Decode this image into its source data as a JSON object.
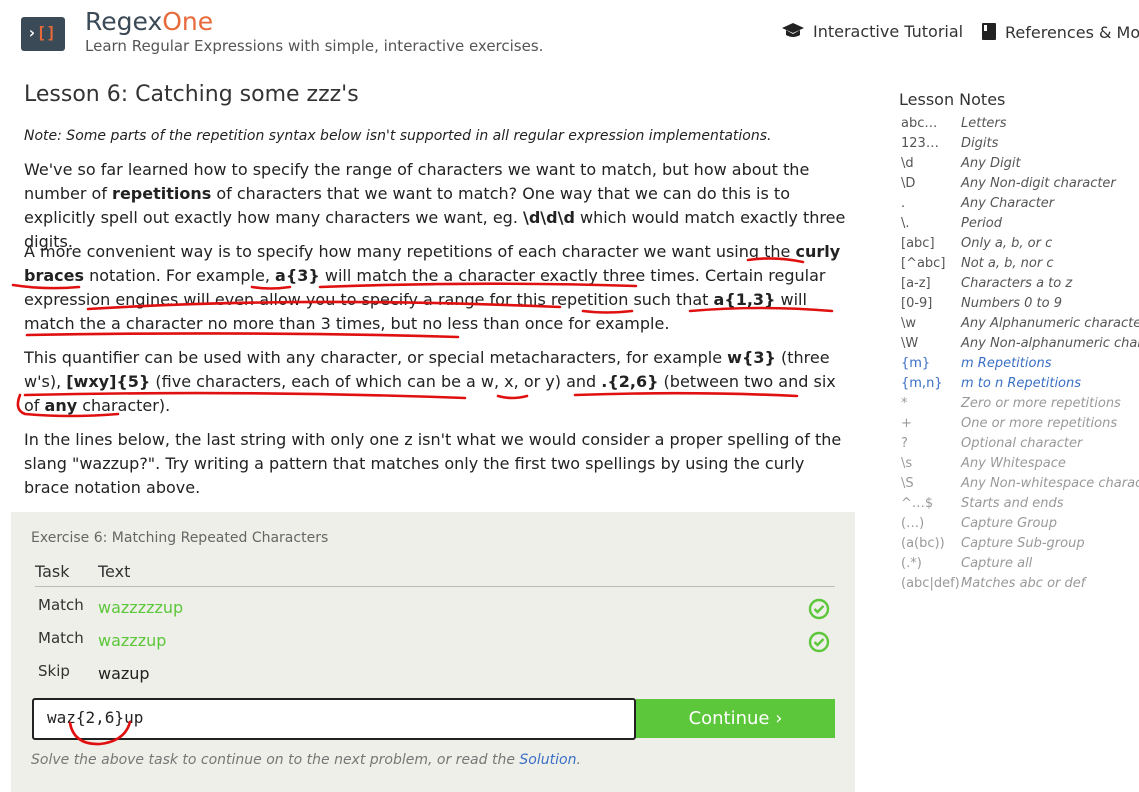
{
  "header": {
    "brand_prefix": "Regex",
    "brand_suffix": "One",
    "tagline": "Learn Regular Expressions with simple, interactive exercises.",
    "nav_tutorial": "Interactive Tutorial",
    "nav_references": "References & Mor"
  },
  "lesson": {
    "title": "Lesson 6: Catching some zzz's",
    "note": "Note: Some parts of the repetition syntax below isn't supported in all regular expression implementations.",
    "p1": [
      {
        "t": "We've so far learned how to specify the range of characters we want to match, but how about the number of "
      },
      {
        "t": "repetitions",
        "b": true
      },
      {
        "t": " of characters that we want to match? One way that we can do this is to explicitly spell out exactly how many characters we want, eg. "
      },
      {
        "t": "\\d\\d\\d",
        "b": true
      },
      {
        "t": " which would match exactly three digits."
      }
    ],
    "p2": [
      {
        "t": "A more convenient way is to specify how many repetitions of each character we want using the "
      },
      {
        "t": "curly braces",
        "b": true
      },
      {
        "t": " notation. For example, "
      },
      {
        "t": "a{3}",
        "b": true
      },
      {
        "t": " will match the a character exactly three times. Certain regular expression engines will even allow you to specify a range for this repetition such that "
      },
      {
        "t": "a{1,3}",
        "b": true
      },
      {
        "t": " will match the a character no more than 3 times, but no less than once for example."
      }
    ],
    "p3": [
      {
        "t": "This quantifier can be used with any character, or special metacharacters, for example "
      },
      {
        "t": "w{3}",
        "b": true
      },
      {
        "t": " (three w's), "
      },
      {
        "t": "[wxy]{5}",
        "b": true
      },
      {
        "t": " (five characters, each of which can be a w, x, or y) and "
      },
      {
        "t": ".{2,6}",
        "b": true
      },
      {
        "t": " (between two and six of "
      },
      {
        "t": "any",
        "b": true
      },
      {
        "t": " character)."
      }
    ],
    "p4": "In the lines below, the last string with only one z isn't what we would consider a proper spelling of the slang \"wazzup?\". Try writing a pattern that matches only the first two spellings by using the curly brace notation above."
  },
  "exercise": {
    "title": "Exercise 6: Matching Repeated Characters",
    "col_task": "Task",
    "col_text": "Text",
    "rows": [
      {
        "task": "Match",
        "text": "wazzzzzup"
      },
      {
        "task": "Match",
        "text": "wazzzup"
      },
      {
        "task": "Skip",
        "text": "wazup"
      }
    ],
    "input_value": "waz{2,6}up",
    "continue_label": "Continue ›",
    "hint_prefix": "Solve the above task to continue on to the next problem, or read the ",
    "hint_link": "Solution",
    "hint_suffix": "."
  },
  "notes": {
    "title": "Lesson Notes",
    "items": [
      {
        "k": "abc…",
        "v": "Letters",
        "s": "n"
      },
      {
        "k": "123…",
        "v": "Digits",
        "s": "n"
      },
      {
        "k": "\\d",
        "v": "Any Digit",
        "s": "n"
      },
      {
        "k": "\\D",
        "v": "Any Non-digit character",
        "s": "n"
      },
      {
        "k": ".",
        "v": "Any Character",
        "s": "n"
      },
      {
        "k": "\\.",
        "v": "Period",
        "s": "n"
      },
      {
        "k": "[abc]",
        "v": "Only a, b, or c",
        "s": "n"
      },
      {
        "k": "[^abc]",
        "v": "Not a, b, nor c",
        "s": "n"
      },
      {
        "k": "[a-z]",
        "v": "Characters a to z",
        "s": "n"
      },
      {
        "k": "[0-9]",
        "v": "Numbers 0 to 9",
        "s": "n"
      },
      {
        "k": "\\w",
        "v": "Any Alphanumeric character",
        "s": "n"
      },
      {
        "k": "\\W",
        "v": "Any Non-alphanumeric charac",
        "s": "n"
      },
      {
        "k": "{m}",
        "v": "m Repetitions",
        "s": "hl"
      },
      {
        "k": "{m,n}",
        "v": "m to n Repetitions",
        "s": "hl"
      },
      {
        "k": "*",
        "v": "Zero or more repetitions",
        "s": "dim"
      },
      {
        "k": "+",
        "v": "One or more repetitions",
        "s": "dim"
      },
      {
        "k": "?",
        "v": "Optional character",
        "s": "dim"
      },
      {
        "k": "\\s",
        "v": "Any Whitespace",
        "s": "dim"
      },
      {
        "k": "\\S",
        "v": "Any Non-whitespace characte",
        "s": "dim"
      },
      {
        "k": "^…$",
        "v": "Starts and ends",
        "s": "dim"
      },
      {
        "k": "(…)",
        "v": "Capture Group",
        "s": "dim"
      },
      {
        "k": "(a(bc))",
        "v": "Capture Sub-group",
        "s": "dim"
      },
      {
        "k": "(.*)",
        "v": "Capture all",
        "s": "dim"
      },
      {
        "k": "(abc|def)",
        "v": "Matches abc or def",
        "s": "dim"
      }
    ]
  },
  "colors": {
    "accent": "#e86a3a",
    "success": "#5cc73a",
    "link": "#3a6fc4",
    "annotation": "#e01010"
  },
  "icons": [
    "logo-icon",
    "graduation-cap-icon",
    "book-icon",
    "check-circle-icon"
  ]
}
